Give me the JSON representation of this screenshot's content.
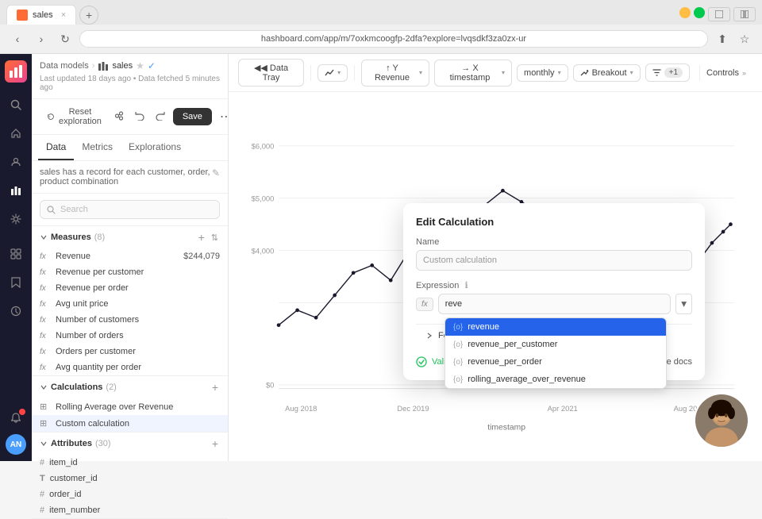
{
  "browser": {
    "tab_label": "sales",
    "url": "hashboard.com/app/m/7oxkmcoogfp-2dfa?explore=lvqsdkf3za0zx-ur",
    "back_title": "Back",
    "forward_title": "Forward",
    "refresh_title": "Refresh"
  },
  "app_header": {
    "breadcrumb_parent": "Data models",
    "breadcrumb_separator": "›",
    "breadcrumb_current": "sales",
    "meta": "Last updated 18 days ago • Data fetched 5 minutes ago",
    "reset_btn": "Reset exploration",
    "save_btn": "Save",
    "more_btn": "⋯"
  },
  "sidebar_tabs": {
    "data_label": "Data",
    "metrics_label": "Metrics",
    "explorations_label": "Explorations"
  },
  "description": "sales has a record for each customer, order, product combination",
  "search_placeholder": "Search",
  "measures": {
    "title": "Measures",
    "count": "(8)",
    "items": [
      {
        "name": "Revenue",
        "value": "$244,079"
      },
      {
        "name": "Revenue per customer",
        "value": ""
      },
      {
        "name": "Revenue per order",
        "value": ""
      },
      {
        "name": "Avg unit price",
        "value": ""
      },
      {
        "name": "Number of customers",
        "value": ""
      },
      {
        "name": "Number of orders",
        "value": ""
      },
      {
        "name": "Orders per customer",
        "value": ""
      },
      {
        "name": "Avg quantity per order",
        "value": ""
      }
    ]
  },
  "calculations": {
    "title": "Calculations",
    "count": "(2)",
    "items": [
      {
        "name": "Rolling Average over Revenue"
      },
      {
        "name": "Custom calculation"
      }
    ]
  },
  "attributes": {
    "title": "Attributes",
    "count": "(30)",
    "items": [
      {
        "name": "item_id",
        "type": "#"
      },
      {
        "name": "customer_id",
        "type": "T"
      },
      {
        "name": "order_id",
        "type": "#"
      },
      {
        "name": "item_number",
        "type": "#"
      }
    ]
  },
  "toolbar": {
    "data_tray": "◀◀ Data Tray",
    "chart_icon": "↗",
    "y_axis": "↑ Y Revenue",
    "x_axis": "→ X timestamp",
    "granularity": "monthly",
    "breakout": "Breakout",
    "filter_count": "+1",
    "controls": "Controls"
  },
  "chart": {
    "y_labels": [
      "$6,000",
      "$5,000",
      "$4,000",
      "$0"
    ],
    "x_labels": [
      "Aug 2018",
      "Dec 2019",
      "Apr 2021",
      "Aug 2022"
    ],
    "x_axis_title": "timestamp"
  },
  "modal": {
    "title": "Edit Calculation",
    "name_label": "Name",
    "name_placeholder": "Custom calculation",
    "expression_label": "Expression",
    "expression_info": "ℹ",
    "fx_badge": "fx",
    "expression_value": "reve",
    "format_section": "Format",
    "valid_text": "Valid expression",
    "read_docs": "Read the docs"
  },
  "autocomplete": {
    "items": [
      {
        "label": "revenue",
        "selected": true
      },
      {
        "label": "revenue_per_customer",
        "selected": false
      },
      {
        "label": "revenue_per_order",
        "selected": false
      },
      {
        "label": "rolling_average_over_revenue",
        "selected": false
      }
    ]
  },
  "nav_icons": [
    {
      "name": "search",
      "symbol": "🔍"
    },
    {
      "name": "home",
      "symbol": "⌂"
    },
    {
      "name": "person",
      "symbol": "👤"
    },
    {
      "name": "settings",
      "symbol": "⚙"
    },
    {
      "name": "grid",
      "symbol": "⊞"
    },
    {
      "name": "bookmark",
      "symbol": "☆"
    },
    {
      "name": "clock",
      "symbol": "🕐"
    },
    {
      "name": "notification",
      "symbol": "🔔",
      "has_dot": true
    }
  ]
}
